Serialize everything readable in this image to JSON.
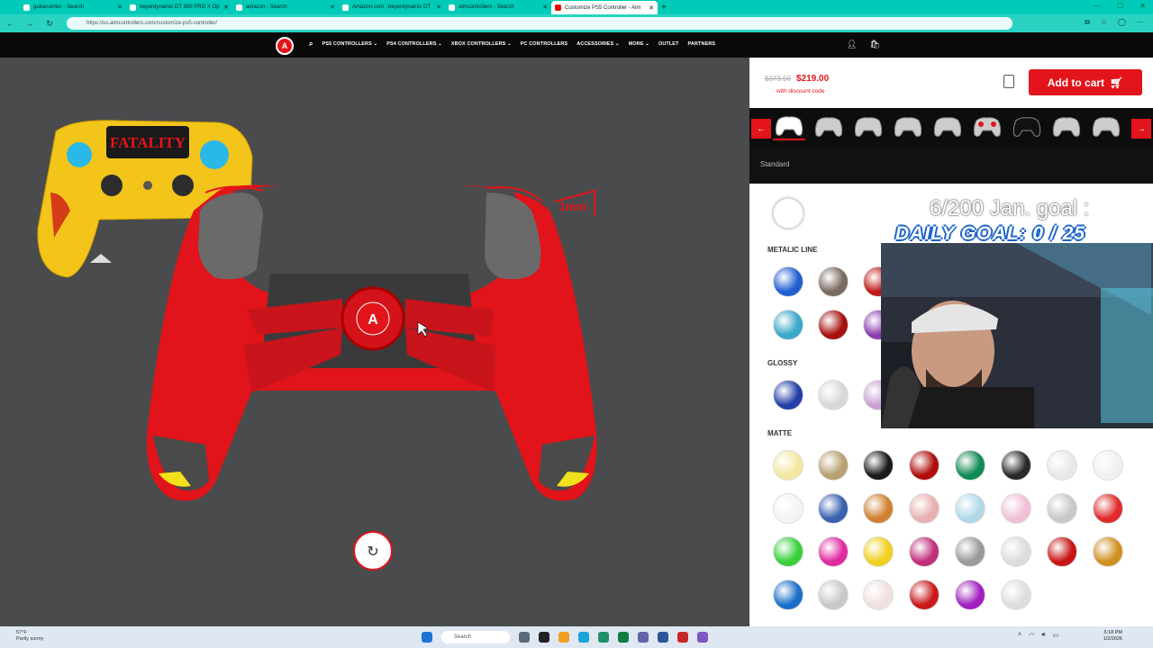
{
  "browser": {
    "tabs": [
      {
        "label": "guitarcenter - Search",
        "active": false
      },
      {
        "label": "beyerdynamic DT 990 PRO X Op",
        "active": false
      },
      {
        "label": "amazon - Search",
        "active": false
      },
      {
        "label": "Amazon.com : beyerdynamic DT",
        "active": false
      },
      {
        "label": "aimcontrollers - Search",
        "active": false
      },
      {
        "label": "Customize PS5 Controller - Aim",
        "active": true
      }
    ],
    "url": "https://us.aimcontrollers.com/customize-ps5-controller/"
  },
  "site": {
    "logo_letter": "A",
    "menu": [
      "PS5 CONTROLLERS ⌄",
      "PS4 CONTROLLERS ⌄",
      "XBOX CONTROLLERS ⌄",
      "PC CONTROLLERS",
      "ACCESSORIES ⌄",
      "MORE ⌄",
      "OUTLET",
      "PARTNERS"
    ]
  },
  "stage": {
    "preview_text": "FATALITY",
    "annotation": "1mm"
  },
  "panel": {
    "old_price": "$373.50",
    "price": "$219.00",
    "discount_note": "with discount code",
    "add_to_cart": "Add to cart",
    "standard_label": "Standard",
    "sections": [
      "METALIC LINE",
      "GLOSSY",
      "MATTE"
    ]
  },
  "overlay": {
    "goal_line": "6/200 Jan. goal :",
    "daily_goal": "DAILY GOAL: 0 / 25"
  },
  "taskbar": {
    "weather_temp": "57°F",
    "weather_desc": "Partly sunny",
    "search_placeholder": "Search",
    "time": "6:18 PM",
    "date": "1/2/2026"
  },
  "colors": {
    "brand_red": "#e3141b",
    "browser_teal": "#00cbb8",
    "controller_red": "#e0141a",
    "stage_gray": "#4a4b4c"
  }
}
